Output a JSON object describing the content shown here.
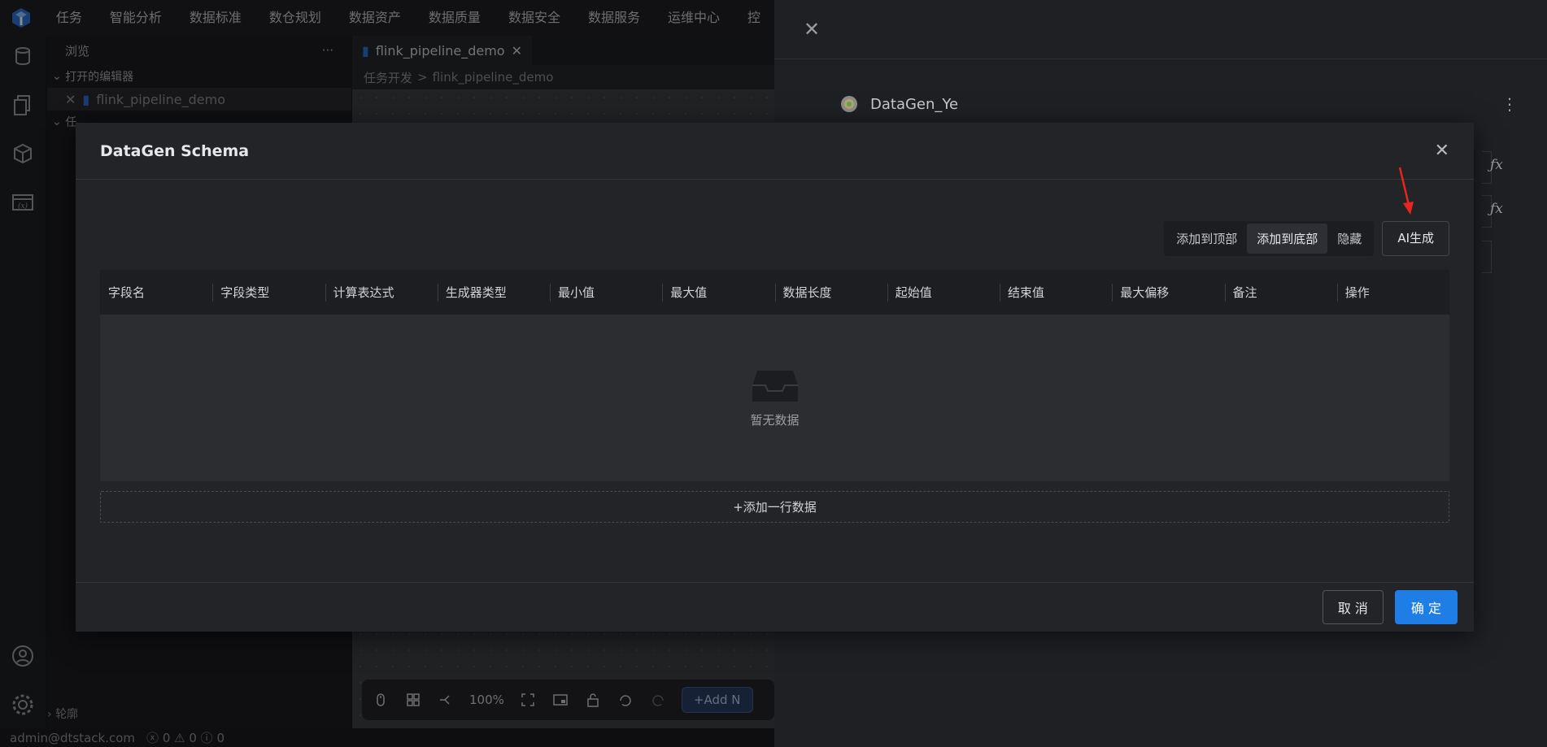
{
  "colors": {
    "accent": "#1f7ee6",
    "arrow": "#e8251f",
    "logo": "#2f6fd6"
  },
  "top_menu": [
    "任务",
    "智能分析",
    "数据标准",
    "数仓规划",
    "数据资产",
    "数据质量",
    "数据安全",
    "数据服务",
    "运维中心",
    "控"
  ],
  "sidebar": {
    "header": "浏览",
    "more": "···",
    "section_open_editors": "打开的编辑器",
    "open_file": "flink_pipeline_demo",
    "section_task": "任",
    "outline": "轮廓"
  },
  "editor": {
    "tab_label": "flink_pipeline_demo",
    "breadcrumb": [
      "任务开发",
      "flink_pipeline_demo"
    ],
    "breadcrumb_sep": ">",
    "zoom": "100%",
    "add_node": "+Add N"
  },
  "right_panel": {
    "title": "DataGen_Ye",
    "fx": "ƒx"
  },
  "status": {
    "user": "admin@dtstack.com",
    "errors": "0",
    "warnings": "0",
    "infos": "0"
  },
  "modal": {
    "title": "DataGen Schema",
    "actions": {
      "add_top": "添加到顶部",
      "add_bottom": "添加到底部",
      "hide": "隐藏",
      "ai_generate": "AI生成"
    },
    "columns": [
      "字段名",
      "字段类型",
      "计算表达式",
      "生成器类型",
      "最小值",
      "最大值",
      "数据长度",
      "起始值",
      "结束值",
      "最大偏移",
      "备注",
      "操作"
    ],
    "empty_text": "暂无数据",
    "add_row": "+添加一行数据",
    "cancel": "取 消",
    "confirm": "确 定"
  }
}
